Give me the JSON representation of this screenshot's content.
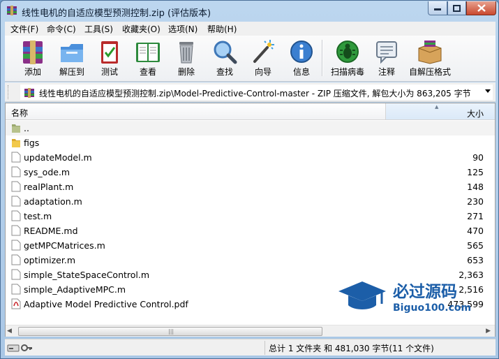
{
  "window": {
    "title": "线性电机的自适应模型预测控制.zip (评估版本)"
  },
  "menu": {
    "items": [
      "文件(F)",
      "命令(C)",
      "工具(S)",
      "收藏夹(O)",
      "选项(N)",
      "帮助(H)"
    ]
  },
  "toolbar": {
    "buttons": [
      {
        "label": "添加",
        "icon": "add-archive-icon"
      },
      {
        "label": "解压到",
        "icon": "extract-to-icon"
      },
      {
        "label": "测试",
        "icon": "test-clipboard-icon"
      },
      {
        "label": "查看",
        "icon": "view-book-icon"
      },
      {
        "label": "删除",
        "icon": "delete-trash-icon"
      },
      {
        "label": "查找",
        "icon": "find-magnifier-icon"
      },
      {
        "label": "向导",
        "icon": "wizard-wand-icon"
      },
      {
        "label": "信息",
        "icon": "info-icon"
      },
      {
        "label": "扫描病毒",
        "icon": "virus-scan-icon"
      },
      {
        "label": "注释",
        "icon": "comment-icon"
      },
      {
        "label": "自解压格式",
        "icon": "sfx-box-icon"
      }
    ]
  },
  "address": {
    "path": "线性电机的自适应模型预测控制.zip\\Model-Predictive-Control-master - ZIP 压缩文件, 解包大小为 863,205 字节"
  },
  "list": {
    "columns": {
      "name": "名称",
      "size": "大小"
    },
    "rows": [
      {
        "name": "..",
        "size": "",
        "type": "up"
      },
      {
        "name": "figs",
        "size": "",
        "type": "folder"
      },
      {
        "name": "updateModel.m",
        "size": "90",
        "type": "file"
      },
      {
        "name": "sys_ode.m",
        "size": "125",
        "type": "file"
      },
      {
        "name": "realPlant.m",
        "size": "148",
        "type": "file"
      },
      {
        "name": "adaptation.m",
        "size": "230",
        "type": "file"
      },
      {
        "name": "test.m",
        "size": "271",
        "type": "file"
      },
      {
        "name": "README.md",
        "size": "470",
        "type": "file"
      },
      {
        "name": "getMPCMatrices.m",
        "size": "565",
        "type": "file"
      },
      {
        "name": "optimizer.m",
        "size": "653",
        "type": "file"
      },
      {
        "name": "simple_StateSpaceControl.m",
        "size": "2,363",
        "type": "file"
      },
      {
        "name": "simple_AdaptiveMPC.m",
        "size": "2,516",
        "type": "file"
      },
      {
        "name": "Adaptive Model Predictive Control.pdf",
        "size": "473,599",
        "type": "pdf"
      }
    ]
  },
  "status": {
    "summary": "总计 1 文件夹 和 481,030 字节(11 个文件)"
  },
  "watermark": {
    "title": "必过源码",
    "site": "Biguo100.com"
  },
  "colors": {
    "accent": "#1c5ea8",
    "title_bg": "#bcd6ef",
    "close_btn": "#c9492e"
  }
}
